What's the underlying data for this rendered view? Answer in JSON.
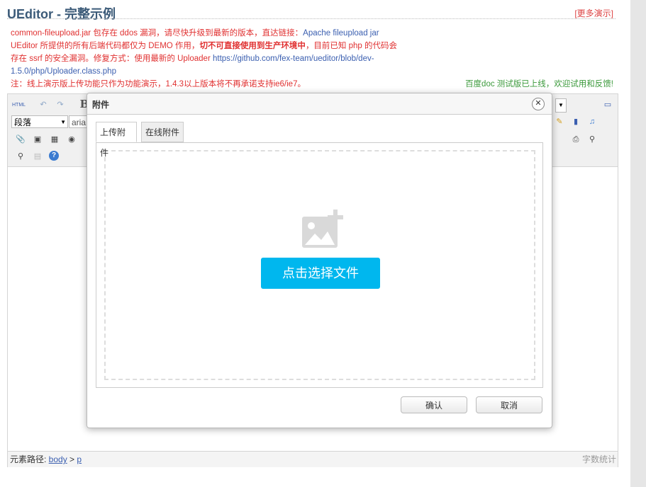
{
  "header": {
    "title": "UEditor - 完整示例",
    "more_link": "[更多演示]"
  },
  "notice": {
    "part1": "common-fileupload.jar 包存在 ddos 漏洞，请尽快升级到最新的版本，直达链接：",
    "link1": "Apache fileupload jar",
    "part2": "UEditor 所提供的所有后端代码都仅为 DEMO 作用，",
    "bold": "切不可直接使用到生产环境中",
    "part3": "，目前已知 php 的代码会存在 ssrf 的安全漏洞。修复方式：使用最新的 Uploader ",
    "link2": "https://github.com/fex-team/ueditor/blob/dev-1.5.0/php/Uploader.class.php",
    "line2": "注：线上演示版上传功能只作为功能演示，1.4.3以上版本将不再承诺支持ie6/ie7。",
    "online": "百度doc 测试版已上线，欢迎试用和反馈!"
  },
  "toolbar": {
    "html_label": "HTML",
    "bold_label": "B",
    "paragraph_select": "段落",
    "font_select": "aria",
    "icons": [
      "html-icon",
      "undo-icon",
      "redo-icon",
      "bold-icon",
      "attachment-icon",
      "image-icon",
      "insert-image-icon",
      "link-icon",
      "find-replace-icon",
      "template-icon",
      "help-icon",
      "preview-icon",
      "video-icon",
      "music-icon",
      "emoticon-icon",
      "print-icon",
      "zoom-icon"
    ]
  },
  "statusbar": {
    "path_label": "元素路径: ",
    "path_body": "body",
    "path_sep": " > ",
    "path_p": "p",
    "word_count": "字数统计"
  },
  "dialog": {
    "title": "附件",
    "close": "✕",
    "tabs": [
      "上传附件",
      "在线附件"
    ],
    "choose_button": "点击选择文件",
    "ok": "确认",
    "cancel": "取消"
  },
  "colors": {
    "accent": "#00b7ee",
    "notice_red": "#e03030",
    "link_blue": "#3b5fb0",
    "online_green": "#3c9a3c"
  }
}
